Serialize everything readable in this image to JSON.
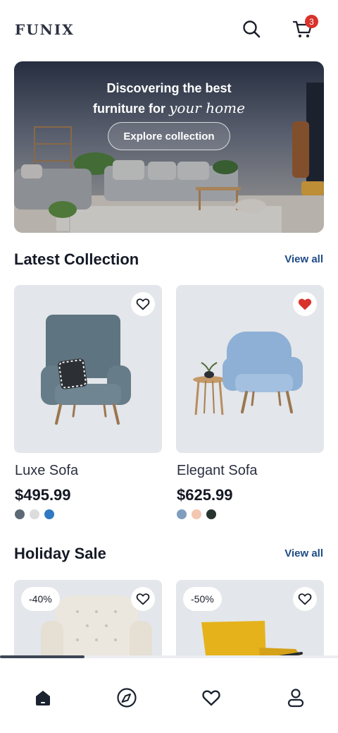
{
  "header": {
    "logo": "FUNIX",
    "search_icon": "search-icon",
    "cart_icon": "cart-icon",
    "cart_count": "3"
  },
  "hero": {
    "line1": "Discovering the best",
    "line2_plain": "furniture for",
    "line2_script": "your home",
    "button_label": "Explore collection"
  },
  "latest": {
    "title": "Latest Collection",
    "view_all": "View all",
    "products": [
      {
        "name": "Luxe Sofa",
        "price": "$495.99",
        "favorited": false,
        "swatches": [
          "#5d6a76",
          "#dcdcdc",
          "#2f79c2"
        ]
      },
      {
        "name": "Elegant Sofa",
        "price": "$625.99",
        "favorited": true,
        "swatches": [
          "#7f9dbd",
          "#f3c7b1",
          "#27342e"
        ]
      }
    ]
  },
  "holiday": {
    "title": "Holiday Sale",
    "view_all": "View all",
    "products": [
      {
        "discount": "-40%",
        "favorited": false
      },
      {
        "discount": "-50%",
        "favorited": false
      }
    ]
  },
  "nav": {
    "items": [
      "home-icon",
      "explore-icon",
      "favorites-icon",
      "profile-icon"
    ],
    "active": "home-icon"
  },
  "colors": {
    "accent": "#1e4b86",
    "badge": "#d8322b",
    "card_bg": "#e3e6ea",
    "text_dark": "#151a26"
  }
}
